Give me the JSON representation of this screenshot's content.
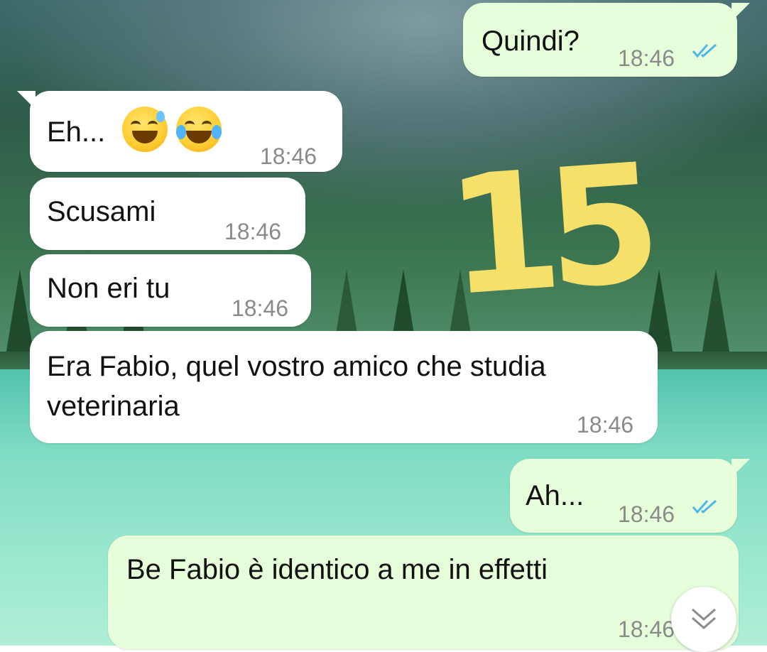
{
  "sticker_text": "15",
  "messages": [
    {
      "id": "m1",
      "direction": "outgoing",
      "text": "Quindi?",
      "time": "18:46",
      "status": "read"
    },
    {
      "id": "m2",
      "direction": "incoming",
      "text": "Eh...",
      "emojis": [
        "grinning-sweat-emoji",
        "tears-of-joy-emoji"
      ],
      "time": "18:46"
    },
    {
      "id": "m3",
      "direction": "incoming",
      "text": "Scusami",
      "time": "18:46"
    },
    {
      "id": "m4",
      "direction": "incoming",
      "text": "Non eri tu",
      "time": "18:46"
    },
    {
      "id": "m5",
      "direction": "incoming",
      "text_line1": "Era Fabio, quel vostro amico che studia",
      "text_line2": "veterinaria",
      "time": "18:46"
    },
    {
      "id": "m6",
      "direction": "outgoing",
      "text": "Ah...",
      "time": "18:46",
      "status": "read"
    },
    {
      "id": "m7",
      "direction": "outgoing",
      "text": "Be Fabio è identico a me in effetti",
      "time": "18:46"
    }
  ],
  "colors": {
    "incoming_bubble": "#ffffff",
    "outgoing_bubble": "#e6ffda",
    "read_ticks": "#4fb6ec",
    "sticker": "#f5e06a"
  },
  "icons": {
    "read_receipt": "double-check-icon",
    "scroll_down": "chevron-double-down-icon"
  }
}
